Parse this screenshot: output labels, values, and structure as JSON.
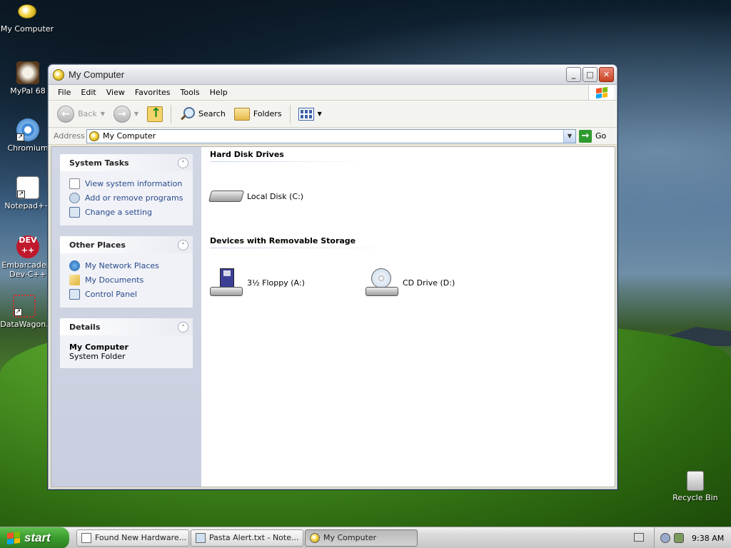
{
  "desktop": {
    "icons": [
      {
        "label": "My Computer"
      },
      {
        "label": "MyPal 68"
      },
      {
        "label": "Chromium"
      },
      {
        "label": "Notepad++"
      },
      {
        "label": "Embarcadero Dev-C++",
        "line1": "Embarcadero",
        "line2": "Dev-C++"
      },
      {
        "label": "DataWagon."
      },
      {
        "label": "Recycle Bin"
      }
    ]
  },
  "window": {
    "title": "My Computer",
    "menu": [
      "File",
      "Edit",
      "View",
      "Favorites",
      "Tools",
      "Help"
    ],
    "toolbar": {
      "back_label": "Back",
      "search_label": "Search",
      "folders_label": "Folders"
    },
    "address": {
      "label": "Address",
      "value": "My Computer",
      "go_label": "Go"
    },
    "sidebar": {
      "system_tasks": {
        "title": "System Tasks",
        "links": [
          "View system information",
          "Add or remove programs",
          "Change a setting"
        ]
      },
      "other_places": {
        "title": "Other Places",
        "links": [
          "My Network Places",
          "My Documents",
          "Control Panel"
        ]
      },
      "details": {
        "title": "Details",
        "name": "My Computer",
        "type": "System Folder"
      }
    },
    "groups": [
      {
        "title": "Hard Disk Drives",
        "items": [
          "Local Disk (C:)"
        ]
      },
      {
        "title": "Devices with Removable Storage",
        "items": [
          "3½ Floppy (A:)",
          "CD Drive (D:)"
        ]
      }
    ]
  },
  "taskbar": {
    "start_label": "start",
    "tasks": [
      "Found New Hardware...",
      "Pasta Alert.txt - Note...",
      "My Computer"
    ],
    "clock": "9:38 AM"
  }
}
